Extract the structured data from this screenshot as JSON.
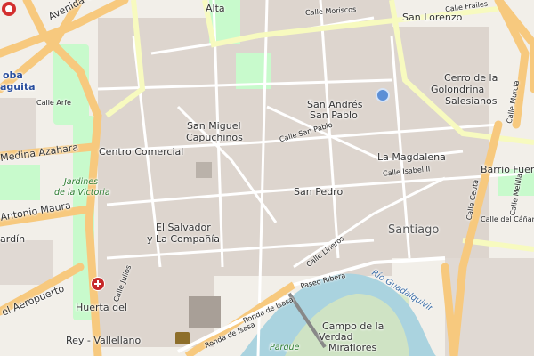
{
  "map": {
    "labels": {
      "avenida_de": "Avenida de",
      "alta": "Alta",
      "calle_moriscos": "Calle Moriscos",
      "calle_frailes": "Calle Frailes",
      "san_lorenzo": "San Lorenzo",
      "oba": "oba",
      "aguita": "aguita",
      "calle_arfe": "Calle Arfe",
      "san_andres": "San Andrés",
      "san_pablo": "San Pablo",
      "cerro_de_la": "Cerro de la",
      "golondrina": "Golondrina",
      "salesianos": "Salesianos",
      "calle_murcia": "Calle Murcia",
      "san_miguel": "San Miguel",
      "capuchinos": "Capuchinos",
      "calle_san_pablo": "Calle San Pablo",
      "medina_azahara": "Medina Azahara",
      "centro_comercial": "Centro Comercial",
      "la_magdalena": "La Magdalena",
      "calle_isabel_ii": "Calle Isabel II",
      "barrio_fuensanta": "Barrio Fuensa",
      "jardines": "Jardines",
      "de_la_victoria": "de la Victoria",
      "san_pedro": "San Pedro",
      "calle_ceuta": "Calle Ceuta",
      "calle_melilla": "Calle Melilla",
      "antonio_maura": "Antonio Maura",
      "calle_del_canamo": "Calle del Cáñamo",
      "el_salvador": "El Salvador",
      "y_la_compania": "y La Compañía",
      "santiago": "Santiago",
      "ardin": "ardín",
      "calle_lineros": "Calle Lineros",
      "calle_julios": "Calle Julios",
      "paseo_ribera": "Paseo Ribera",
      "rio_guadalquivir": "Río Guadalquivir",
      "el_aeropuerto": "el Aeropuerto",
      "huerta_del": "Huerta del",
      "rey_vallellano": "Rey - Vallellano",
      "ronda_de_isasa_1": "Ronda de Isasa",
      "ronda_de_isasa_2": "Ronda de Isasa",
      "campo_de_la": "Campo de la",
      "verdad": "Verdad",
      "miraflores": "Miraflores",
      "parque": "Parque"
    },
    "colors": {
      "background": "#f2efe9",
      "block": "#d9d0c9",
      "main_road": "#f7c97e",
      "secondary_road": "#f7fabf",
      "street": "#ffffff",
      "park": "#c8facc",
      "water": "#aad3df",
      "pin": "#d32f2f",
      "hospital": "#c62828"
    },
    "icons": [
      "location-pin-icon",
      "hospital-icon",
      "castle-icon",
      "info-icon"
    ]
  }
}
